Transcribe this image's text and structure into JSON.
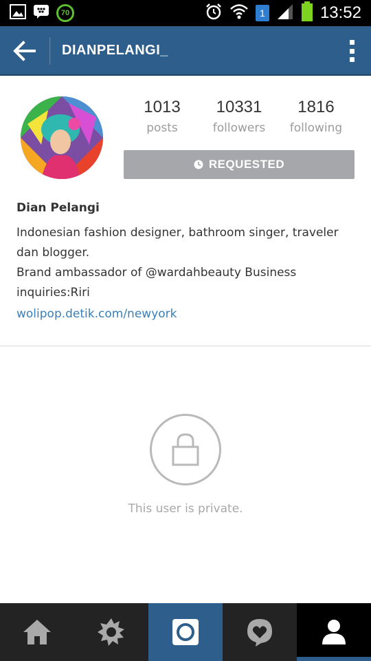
{
  "status_bar": {
    "time": "13:52",
    "battery_badge": "70",
    "sim_badge": "1",
    "icons": [
      "image-icon",
      "bbm-icon",
      "battery-saver-icon",
      "alarm-icon",
      "wifi-icon",
      "signal-icon",
      "battery-icon"
    ]
  },
  "app_bar": {
    "title": "DIANPELANGI_",
    "icons": [
      "back-arrow-icon",
      "overflow-menu-icon"
    ],
    "color": "#2e5e8b"
  },
  "profile": {
    "stats": [
      {
        "value": "1013",
        "label": "posts"
      },
      {
        "value": "10331",
        "label": "followers"
      },
      {
        "value": "1816",
        "label": "following"
      }
    ],
    "requested_label": "REQUESTED",
    "name": "Dian Pelangi",
    "bio_lines": [
      "Indonesian fashion designer, bathroom singer, traveler",
      "dan blogger.",
      "Brand ambassador of @wardahbeauty Business",
      "inquiries:Riri"
    ],
    "website": "wolipop.detik.com/newyork"
  },
  "private_notice": {
    "text": "This user is private.",
    "icon": "lock-icon"
  },
  "bottom_nav": {
    "items": [
      "home-icon",
      "explore-icon",
      "camera-icon",
      "activity-icon",
      "profile-icon"
    ],
    "active": "profile-icon"
  }
}
